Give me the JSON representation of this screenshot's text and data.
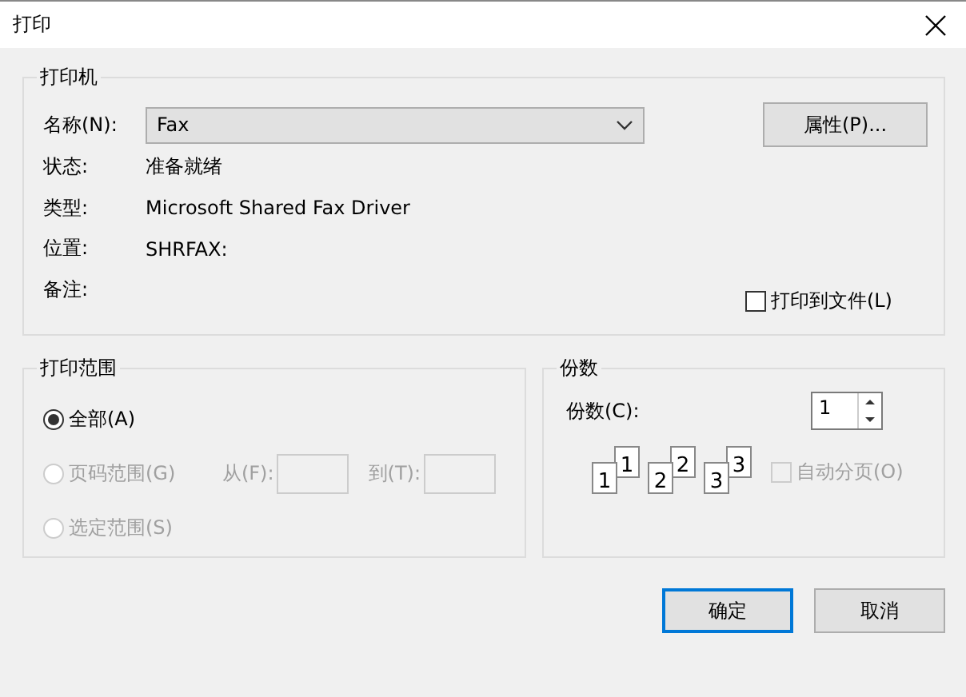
{
  "window": {
    "title": "打印"
  },
  "printer": {
    "group_title": "打印机",
    "name_label": "名称(N):",
    "name_value": "Fax",
    "properties_button": "属性(P)...",
    "info": [
      {
        "label": "状态:",
        "value": "准备就绪"
      },
      {
        "label": "类型:",
        "value": "Microsoft Shared Fax Driver"
      },
      {
        "label": "位置:",
        "value": "SHRFAX:"
      },
      {
        "label": "备注:"
      }
    ],
    "print_to_file": {
      "label": "打印到文件(L)",
      "checked": false
    }
  },
  "range": {
    "group_title": "打印范围",
    "options": [
      {
        "label": "全部(A)",
        "selected": true,
        "disabled": false
      },
      {
        "label": "页码范围(G)",
        "selected": false,
        "disabled": true,
        "fields": [
          {
            "label": "从(F):",
            "disabled": true
          },
          {
            "label": "到(T):",
            "disabled": true
          }
        ]
      },
      {
        "label": "选定范围(S)",
        "selected": false,
        "disabled": true
      }
    ]
  },
  "copies": {
    "group_title": "份数",
    "count_label": "份数(C):",
    "count_value": "1",
    "collate_pages": [
      {
        "back": "1",
        "front": "1"
      },
      {
        "back": "2",
        "front": "2"
      },
      {
        "back": "3",
        "front": "3"
      }
    ],
    "collate": {
      "label": "自动分页(O)",
      "checked": false,
      "disabled": true
    }
  },
  "buttons": [
    {
      "label": "确定",
      "default": true
    },
    {
      "label": "取消",
      "default": false
    }
  ]
}
